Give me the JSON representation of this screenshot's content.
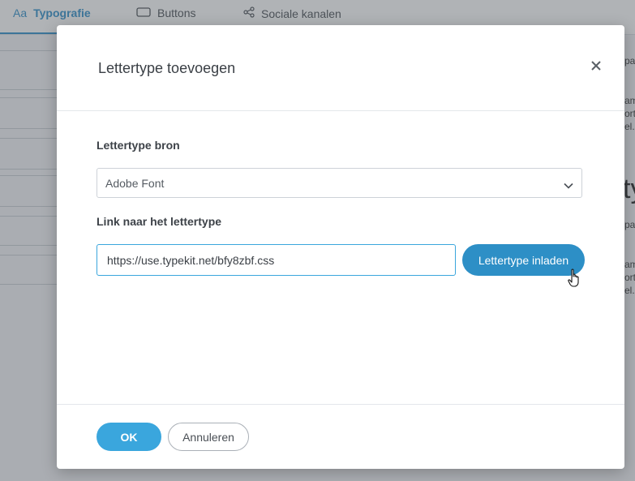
{
  "background": {
    "tabs": [
      {
        "label": "Typografie",
        "icon": "typography-icon",
        "active": true,
        "icon_text": "Aa"
      },
      {
        "label": "Buttons",
        "icon": "button-icon",
        "active": false
      },
      {
        "label": "Sociale kanalen",
        "icon": "share-icon",
        "active": false
      }
    ],
    "right_fragments": [
      "pa",
      "am",
      "ort",
      "el.",
      "ty",
      "pa",
      "am",
      "ort",
      "el."
    ]
  },
  "modal": {
    "title": "Lettertype toevoegen",
    "source_label": "Lettertype bron",
    "source_value": "Adobe Font",
    "link_label": "Link naar het lettertype",
    "link_value": "https://use.typekit.net/bfy8zbf.css",
    "load_button": "Lettertype inladen",
    "ok_button": "OK",
    "cancel_button": "Annuleren"
  },
  "colors": {
    "accent": "#3aa6dd",
    "accent_dark": "#2d8fc6",
    "tab_active": "#2f8fca"
  }
}
